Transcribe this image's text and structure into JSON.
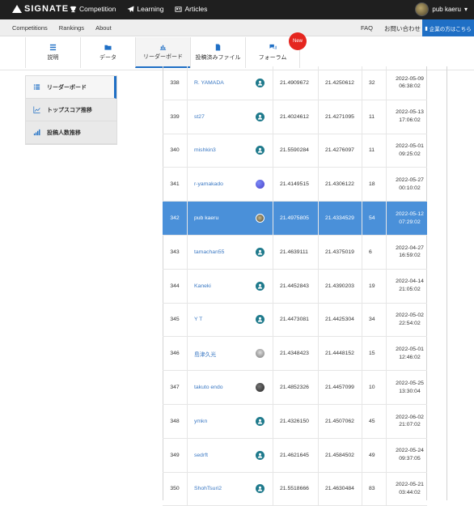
{
  "brand": "SIGNATE",
  "topnav": [
    {
      "label": "Competition",
      "icon": "trophy-icon"
    },
    {
      "label": "Learning",
      "icon": "plane-icon"
    },
    {
      "label": "Articles",
      "icon": "article-icon"
    }
  ],
  "user": {
    "name": "pub kaeru"
  },
  "subnav": {
    "left": [
      "Competitions",
      "Rankings",
      "About"
    ],
    "right": [
      "FAQ",
      "お問い合わせ"
    ],
    "corp_button": "企業の方はこちら"
  },
  "tabs": [
    {
      "label": "説明"
    },
    {
      "label": "データ"
    },
    {
      "label": "リーダーボード"
    },
    {
      "label": "投稿済みファイル"
    },
    {
      "label": "フォーラム",
      "badge": "New"
    }
  ],
  "side_menu": [
    {
      "label": "リーダーボード"
    },
    {
      "label": "トップスコア推移"
    },
    {
      "label": "投稿人数推移"
    }
  ],
  "colors": {
    "accent": "#1f6fc5",
    "highlight_row": "#4a90d9",
    "badge": "#e5261f"
  },
  "leaderboard": [
    {
      "rank": "338",
      "user": "R. YAMADA",
      "avatar": "default",
      "public": "21.4909672",
      "private": "21.4250612",
      "count": "32",
      "date": "2022-05-09",
      "time": "06:38:02"
    },
    {
      "rank": "339",
      "user": "st27",
      "avatar": "default",
      "public": "21.4024612",
      "private": "21.4271095",
      "count": "11",
      "date": "2022-05-13",
      "time": "17:06:02"
    },
    {
      "rank": "340",
      "user": "mishkin3",
      "avatar": "default",
      "public": "21.5590284",
      "private": "21.4276097",
      "count": "11",
      "date": "2022-05-01",
      "time": "09:25:02"
    },
    {
      "rank": "341",
      "user": "r-yamakado",
      "avatar": "blue",
      "public": "21.4149515",
      "private": "21.4306122",
      "count": "18",
      "date": "2022-05-27",
      "time": "00:10:02"
    },
    {
      "rank": "342",
      "user": "pub kaeru",
      "avatar": "photo",
      "public": "21.4975805",
      "private": "21.4334529",
      "count": "54",
      "date": "2022-05-12",
      "time": "07:29:02",
      "highlight": true
    },
    {
      "rank": "343",
      "user": "tamachan55",
      "avatar": "default",
      "public": "21.4639111",
      "private": "21.4375019",
      "count": "6",
      "date": "2022-04-27",
      "time": "16:59:02"
    },
    {
      "rank": "344",
      "user": "Kaneki",
      "avatar": "default",
      "public": "21.4452843",
      "private": "21.4390203",
      "count": "19",
      "date": "2022-04-14",
      "time": "21:05:02"
    },
    {
      "rank": "345",
      "user": "Y T",
      "avatar": "default",
      "public": "21.4473081",
      "private": "21.4425304",
      "count": "34",
      "date": "2022-05-02",
      "time": "22:54:02"
    },
    {
      "rank": "346",
      "user": "島津久光",
      "avatar": "gray",
      "public": "21.4348423",
      "private": "21.4448152",
      "count": "15",
      "date": "2022-05-01",
      "time": "12:46:02"
    },
    {
      "rank": "347",
      "user": "takuto endo",
      "avatar": "dark",
      "public": "21.4852326",
      "private": "21.4457099",
      "count": "10",
      "date": "2022-05-25",
      "time": "13:30:04"
    },
    {
      "rank": "348",
      "user": "ymkn",
      "avatar": "default",
      "public": "21.4326150",
      "private": "21.4507062",
      "count": "45",
      "date": "2022-06-02",
      "time": "21:07:02"
    },
    {
      "rank": "349",
      "user": "sedrft",
      "avatar": "default",
      "public": "21.4621645",
      "private": "21.4584502",
      "count": "49",
      "date": "2022-05-24",
      "time": "09:37:05"
    },
    {
      "rank": "350",
      "user": "ShohTsuri2",
      "avatar": "default",
      "public": "21.5518666",
      "private": "21.4630484",
      "count": "83",
      "date": "2022-05-21",
      "time": "03:44:02"
    }
  ]
}
